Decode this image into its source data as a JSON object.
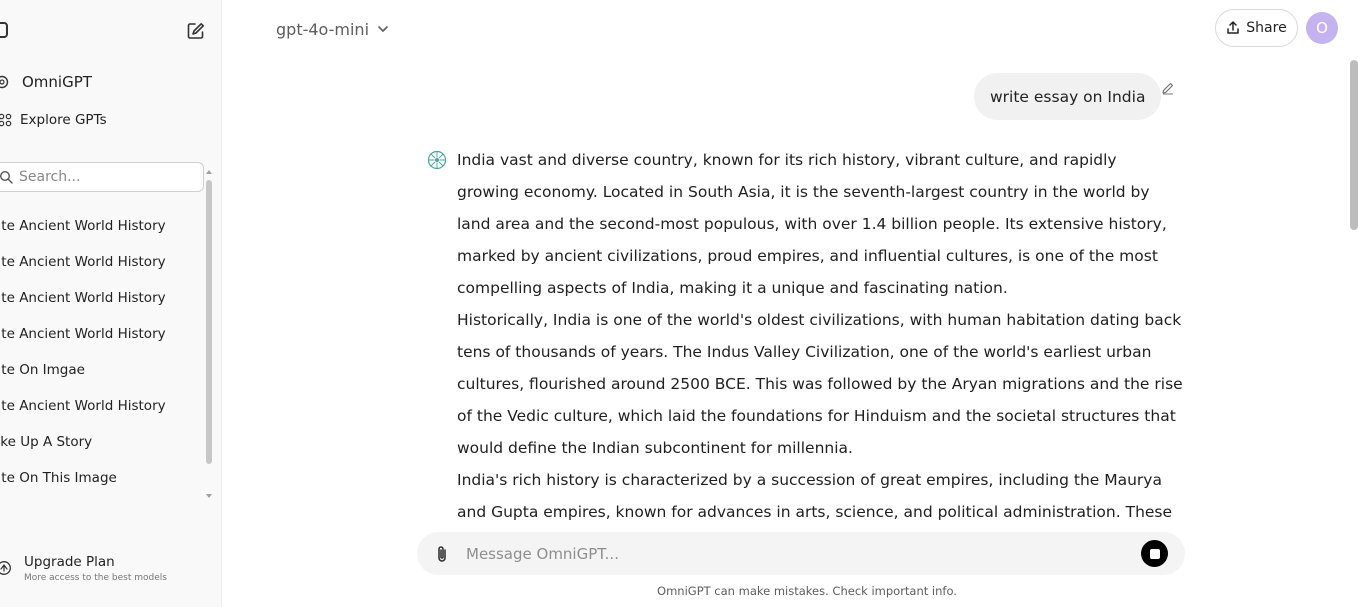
{
  "sidebar": {
    "brand": "OmniGPT",
    "explore": "Explore GPTs",
    "search_placeholder": "Search...",
    "items": [
      {
        "label": "rite Ancient World History"
      },
      {
        "label": "rite Ancient World History"
      },
      {
        "label": "rite Ancient World History"
      },
      {
        "label": "rite Ancient World History"
      },
      {
        "label": "rite On Imgae"
      },
      {
        "label": "rite Ancient World History"
      },
      {
        "label": "ake Up A Story"
      },
      {
        "label": "rite On This Image"
      }
    ],
    "upgrade": {
      "title": "Upgrade Plan",
      "subtitle": "More access to the best models"
    }
  },
  "header": {
    "model": "gpt-4o-mini",
    "share_label": "Share",
    "avatar_initial": "O"
  },
  "chat": {
    "user_message": "write essay on India",
    "assistant_paragraphs": [
      "India vast and diverse country, known for its rich history, vibrant culture, and rapidly growing economy. Located in South Asia, it is the seventh-largest country in the world by land area and the second-most populous, with over 1.4 billion people. Its extensive history, marked by ancient civilizations, proud empires, and influential cultures, is one of the most compelling aspects of India, making it a unique and fascinating nation.",
      "Historically, India is one of the world's oldest civilizations, with human habitation dating back tens of thousands of years. The Indus Valley Civilization, one of the world's earliest urban cultures, flourished around 2500 BCE. This was followed by the Aryan migrations and the rise of the Vedic culture, which laid the foundations for Hinduism and the societal structures that would define the Indian subcontinent for millennia.",
      "India's rich history is characterized by a succession of great empires, including the Maurya and Gupta empires, known for advances in arts, science, and political administration. These empires"
    ]
  },
  "composer": {
    "placeholder": "Message OmniGPT...",
    "disclaimer": "OmniGPT can make mistakes. Check important info."
  }
}
